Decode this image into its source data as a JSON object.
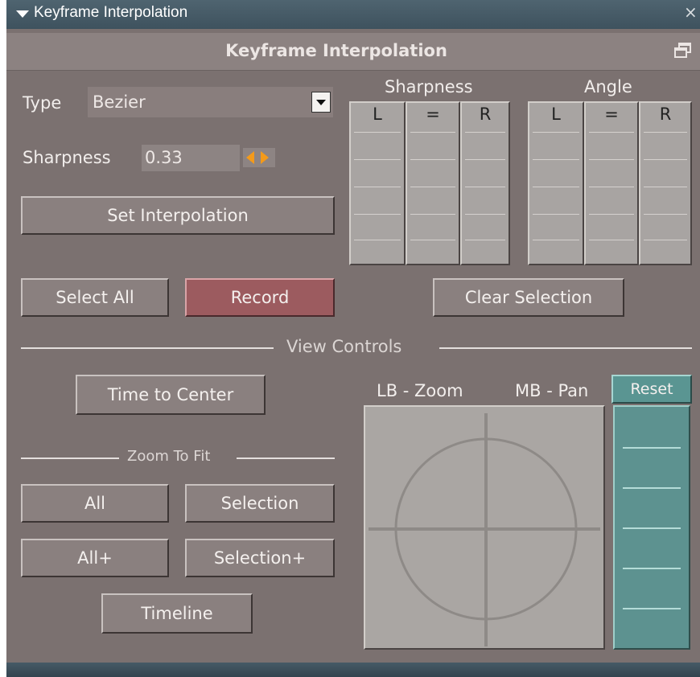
{
  "window": {
    "title": "Keyframe Interpolation",
    "close_glyph": "×"
  },
  "header": {
    "title": "Keyframe Interpolation",
    "float_icon": "restore-window-icon"
  },
  "type": {
    "label": "Type",
    "selected": "Bezier"
  },
  "sharpness": {
    "label": "Sharpness",
    "value": "0.33"
  },
  "buttons": {
    "set_interpolation": "Set Interpolation",
    "select_all": "Select All",
    "record": "Record",
    "clear_selection": "Clear Selection",
    "time_to_center": "Time to Center",
    "all": "All",
    "selection": "Selection",
    "all_plus": "All+",
    "selection_plus": "Selection+",
    "timeline": "Timeline",
    "reset": "Reset"
  },
  "sharpness_group": {
    "title": "Sharpness",
    "columns": [
      "L",
      "=",
      "R"
    ]
  },
  "angle_group": {
    "title": "Angle",
    "columns": [
      "L",
      "=",
      "R"
    ]
  },
  "view_controls": {
    "title": "View Controls",
    "lb_zoom": "LB - Zoom",
    "mb_pan": "MB - Pan"
  },
  "zoom_to_fit": {
    "title": "Zoom To Fit"
  },
  "colors": {
    "panel": "#7b7170",
    "record": "#9c5b5f",
    "reset": "#5a9592",
    "spinner": "#f39a1a"
  }
}
